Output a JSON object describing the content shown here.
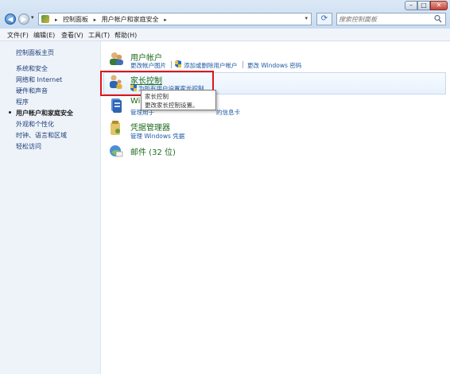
{
  "address_bar": {
    "breadcrumbs": [
      "控制面板",
      "用户帐户和家庭安全"
    ],
    "search_placeholder": "搜索控制面板"
  },
  "menu": {
    "items": [
      "文件(F)",
      "编辑(E)",
      "查看(V)",
      "工具(T)",
      "帮助(H)"
    ]
  },
  "sidebar": {
    "items": [
      {
        "label": "控制面板主页"
      },
      {
        "label": "系统和安全"
      },
      {
        "label": "网络和 Internet"
      },
      {
        "label": "硬件和声音"
      },
      {
        "label": "程序"
      },
      {
        "label": "用户帐户和家庭安全",
        "current": true
      },
      {
        "label": "外观和个性化"
      },
      {
        "label": "时钟、语言和区域"
      },
      {
        "label": "轻松访问"
      }
    ]
  },
  "categories": {
    "user_accounts": {
      "title": "用户帐户",
      "links": [
        "更改帐户图片",
        "添加或删除用户帐户",
        "更改 Windows 密码"
      ]
    },
    "parental_controls": {
      "title": "家长控制",
      "links": [
        "为所有用户设置家长控制"
      ]
    },
    "windows_cardspace": {
      "title_start": "Wi",
      "title_end": "ce",
      "link_start": "管理用于",
      "link_end": "的信息卡"
    },
    "credential_manager": {
      "title": "凭据管理器",
      "links": [
        "管理 Windows 凭据"
      ]
    },
    "mail": {
      "title": "邮件 (32 位)"
    }
  },
  "tooltip": {
    "title": "家长控制",
    "text": "更改家长控制设置。"
  },
  "colors": {
    "category_title": "#1f6b1f",
    "link": "#1e5aa6",
    "highlight": "#e0151b",
    "sidebar_bg": "#eef3fa"
  }
}
